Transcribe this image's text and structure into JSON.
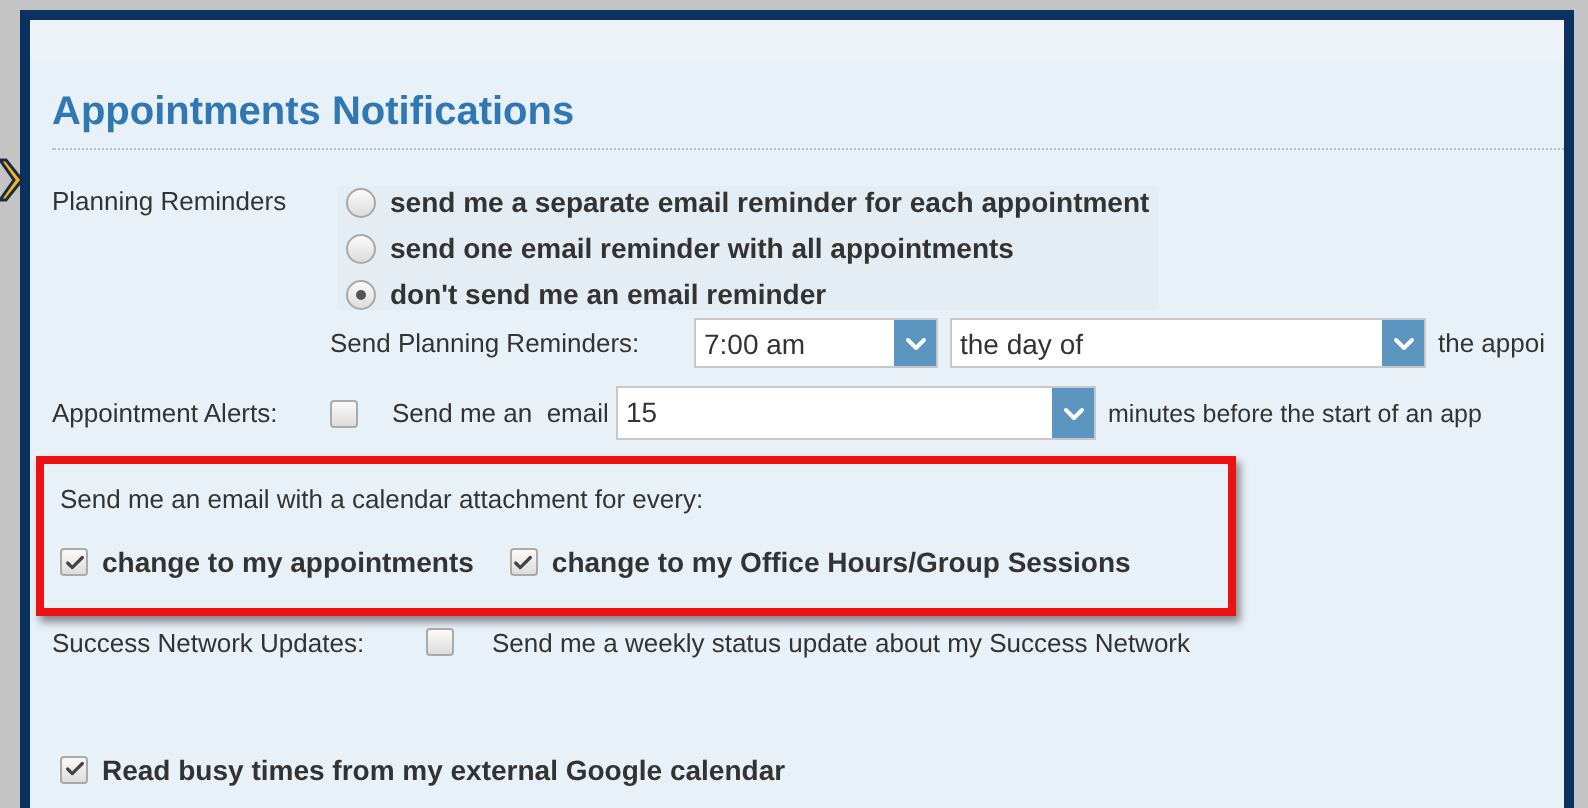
{
  "title": "Appointments Notifications",
  "planning_reminders": {
    "label": "Planning Reminders",
    "options": [
      {
        "label": "send me a separate email reminder for each appointment",
        "selected": false
      },
      {
        "label": "send one email reminder with all appointments",
        "selected": false
      },
      {
        "label": "don't send me an email reminder",
        "selected": true
      }
    ],
    "send_label": "Send Planning Reminders:",
    "time": {
      "value": "7:00 am"
    },
    "day": {
      "value": "the day of"
    },
    "suffix": "the appoi"
  },
  "appointment_alerts": {
    "label": "Appointment Alerts:",
    "checked": false,
    "text": "Send me an  email",
    "minutes": {
      "value": "15"
    },
    "suffix": "minutes before the start of an app"
  },
  "calendar_attachment": {
    "highlighted": true,
    "text": "Send me an email with a calendar attachment for every:",
    "options": [
      {
        "label": "change to my appointments",
        "checked": true
      },
      {
        "label": "change to my Office Hours/Group Sessions",
        "checked": true
      }
    ]
  },
  "success_network": {
    "label": "Success Network Updates:",
    "checked": false,
    "text": "Send me a weekly status update about my Success Network"
  },
  "google_calendar": {
    "label": "Read busy times from my external Google calendar",
    "checked": true
  }
}
